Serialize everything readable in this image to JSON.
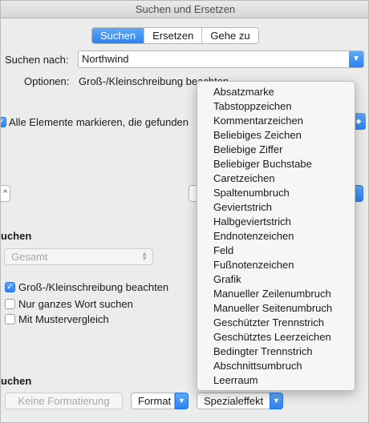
{
  "window": {
    "title": "Suchen und Ersetzen"
  },
  "tabs": [
    "Suchen",
    "Ersetzen",
    "Gehe zu"
  ],
  "search": {
    "label": "Suchen nach:",
    "value": "Northwind",
    "options_label": "Optionen:",
    "options_value": "Groß-/Kleinschreibung beachten"
  },
  "highlight": {
    "label": "Alle Elemente markieren, die gefunden",
    "checked": true
  },
  "search_section": {
    "title": "uchen",
    "direction": "Gesamt",
    "options": [
      {
        "label": "Groß-/Kleinschreibung beachten",
        "checked": true
      },
      {
        "label": "Nur ganzes Wort suchen",
        "checked": false
      },
      {
        "label": "Mit Mustervergleich",
        "checked": false
      }
    ]
  },
  "format_section": {
    "title": "uchen",
    "no_format_label": "Keine Formatierung",
    "format_label": "Format",
    "special_label": "Spezialeffekt"
  },
  "special_menu": [
    "Absatzmarke",
    "Tabstoppzeichen",
    "Kommentarzeichen",
    "Beliebiges Zeichen",
    "Beliebige Ziffer",
    "Beliebiger Buchstabe",
    "Caretzeichen",
    "Spaltenumbruch",
    "Geviertstrich",
    "Halbgeviertstrich",
    "Endnotenzeichen",
    "Feld",
    "Fußnotenzeichen",
    "Grafik",
    "Manueller Zeilenumbruch",
    "Manueller Seitenumbruch",
    "Geschützter Trennstrich",
    "Geschütztes Leerzeichen",
    "Bedingter Trennstrich",
    "Abschnittsumbruch",
    "Leerraum"
  ],
  "colors": {
    "accent": "#2b82f0",
    "window_bg": "#ececec",
    "menu_bg": "#f6f6f6"
  }
}
